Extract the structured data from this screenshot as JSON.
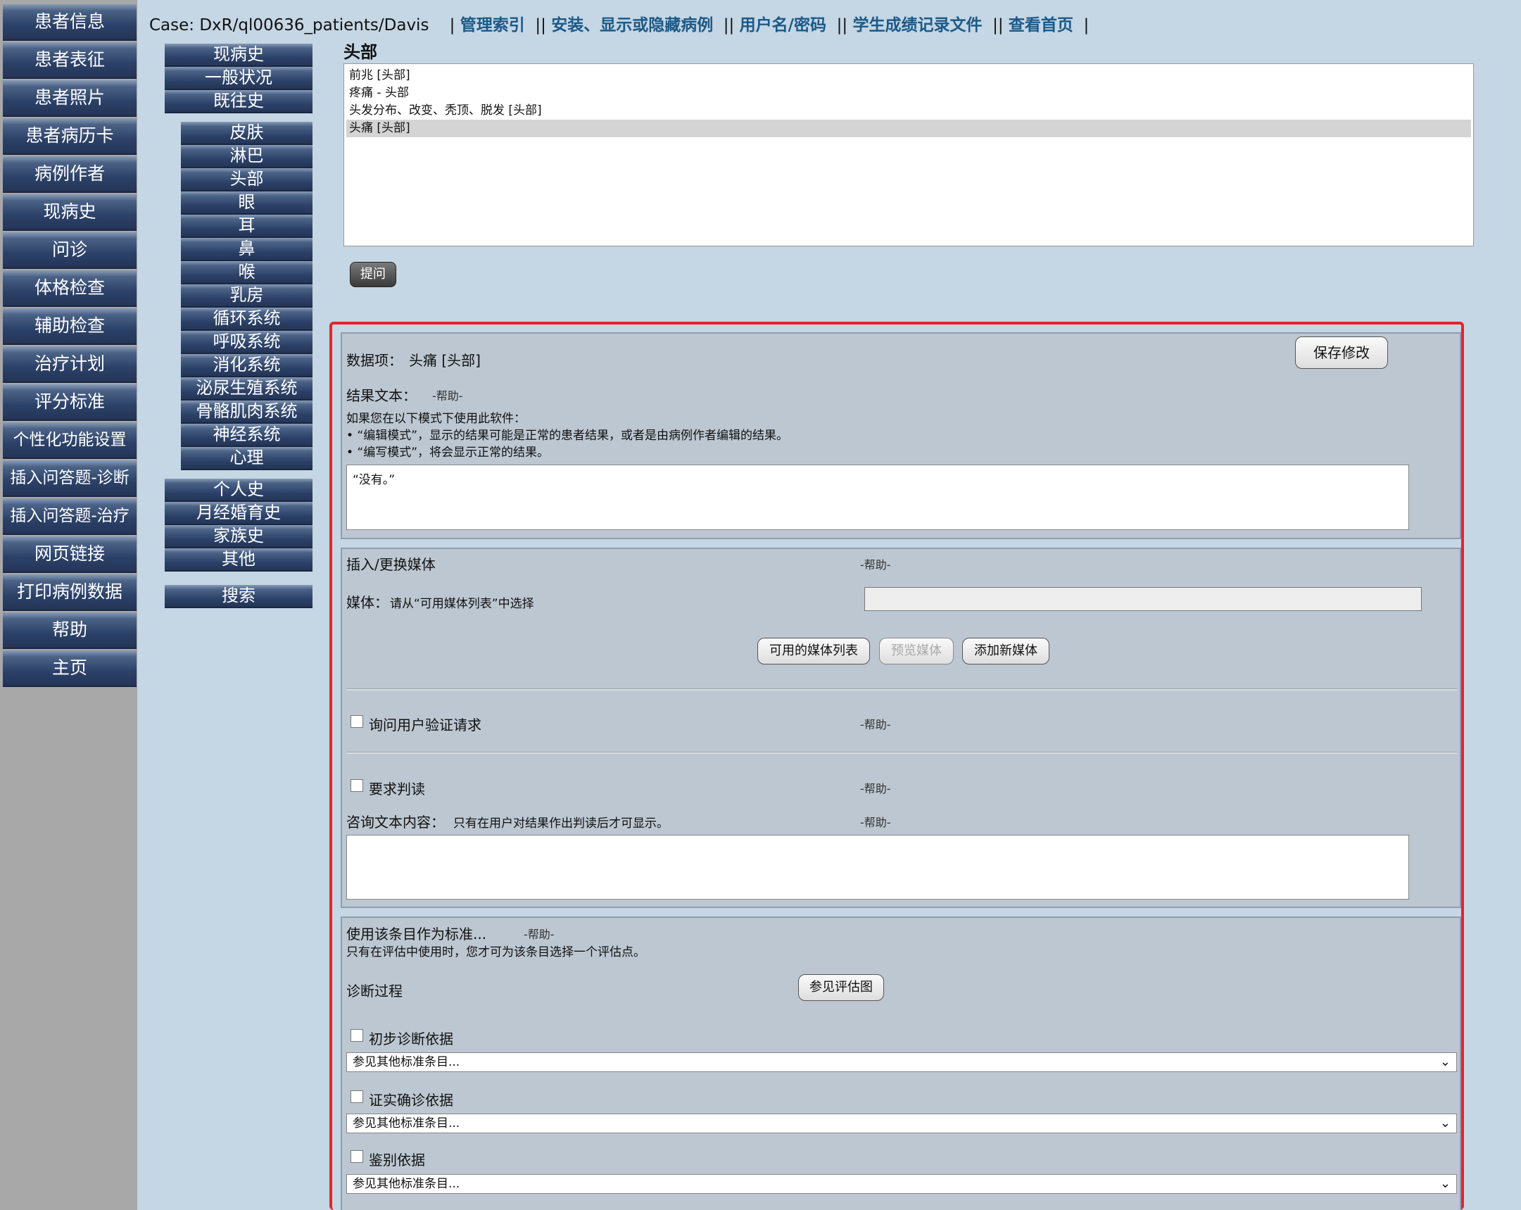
{
  "left_nav": [
    "患者信息",
    "患者表征",
    "患者照片",
    "患者病历卡",
    "病例作者",
    "现病史",
    "问诊",
    "体格检查",
    "辅助检查",
    "治疗计划",
    "评分标准",
    "个性化功能设置",
    "插入问答题-诊断",
    "插入问答题-治疗",
    "网页链接",
    "打印病例数据",
    "帮助",
    "主页"
  ],
  "topbar": {
    "case": "Case: DxR/ql00636_patients/Davis",
    "links": [
      "管理索引",
      "安装、显示或隐藏病例",
      "用户名/密码",
      "学生成绩记录文件",
      "查看首页"
    ]
  },
  "section_nav": {
    "group1": [
      "现病史",
      "一般状况",
      "既往史"
    ],
    "group2": [
      "皮肤",
      "淋巴",
      "头部",
      "眼",
      "耳",
      "鼻",
      "喉",
      "乳房",
      "循环系统",
      "呼吸系统",
      "消化系统",
      "泌尿生殖系统",
      "骨骼肌肉系统",
      "神经系统",
      "心理"
    ],
    "group3": [
      "个人史",
      "月经婚育史",
      "家族史",
      "其他"
    ],
    "search": "搜索"
  },
  "content": {
    "title": "头部",
    "findings": [
      "前兆 [头部]",
      "疼痛 - 头部",
      "头发分布、改变、秃顶、脱发 [头部]",
      "头痛 [头部]"
    ],
    "selected_index": 3,
    "ask_button": "提问"
  },
  "editor": {
    "data_item_label": "数据项：",
    "data_item_value": "头痛 [头部]",
    "save_button": "保存修改",
    "result_label": "结果文本：",
    "help": "-帮助-",
    "mode_intro": "如果您在以下模式下使用此软件：",
    "mode_edit": "• “编辑模式”，显示的结果可能是正常的患者结果，或者是由病例作者编辑的结果。",
    "mode_write": "• “编写模式”，将会显示正常的结果。",
    "result_text": "“没有。”",
    "media_title": "插入/更换媒体",
    "media_label": "媒体：",
    "media_hint": "请从“可用媒体列表”中选择",
    "btn_media_list": "可用的媒体列表",
    "btn_preview": "预览媒体",
    "btn_add_media": "添加新媒体",
    "verify_label": "询问用户验证请求",
    "interpret_label": "要求判读",
    "consult_label": "咨询文本内容：",
    "consult_hint": "只有在用户对结果作出判读后才可显示。",
    "standard_title": "使用该条目作为标准...",
    "standard_note": "只有在评估中使用时，您才可为该条目选择一个评估点。",
    "diag_process": "诊断过程",
    "btn_eval_chart": "参见评估图",
    "criteria": [
      "初步诊断依据",
      "证实确诊依据",
      "鉴别依据"
    ],
    "select_placeholder": "参见其他标准条目..."
  }
}
